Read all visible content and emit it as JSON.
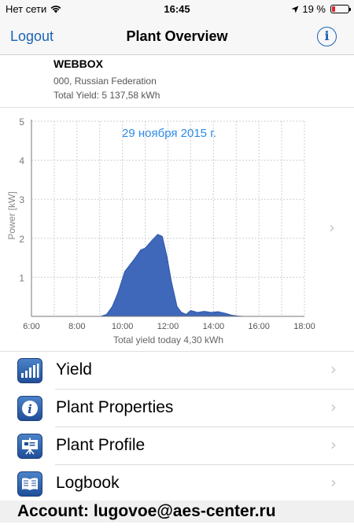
{
  "status_bar": {
    "carrier": "Нет сети",
    "time": "16:45",
    "battery": "19 %",
    "battery_level": 0.19
  },
  "nav": {
    "logout": "Logout",
    "title": "Plant Overview",
    "info_icon": "info-circle-icon"
  },
  "plant": {
    "name": "WEBBOX",
    "location": "000, Russian Federation",
    "total_yield": "Total Yield: 5 137,58 kWh"
  },
  "chart_data": {
    "type": "area",
    "title": "29 ноября 2015 г.",
    "ylabel": "Power [kW]",
    "xlabel": "Total yield today 4,30 kWh",
    "ylim": [
      0,
      5
    ],
    "xlim": [
      6,
      18
    ],
    "y_ticks": [
      "1",
      "2",
      "3",
      "4",
      "5"
    ],
    "x_ticks": [
      "6:00",
      "8:00",
      "10:00",
      "12:00",
      "14:00",
      "16:00",
      "18:00"
    ],
    "x_tick_values": [
      6,
      8,
      10,
      12,
      14,
      16,
      18
    ],
    "grid": true,
    "color": "#3f68ba",
    "x": [
      6,
      9.05,
      9.3,
      9.55,
      9.8,
      10.1,
      10.5,
      10.8,
      11.0,
      11.3,
      11.55,
      11.75,
      11.95,
      12.15,
      12.4,
      12.6,
      12.8,
      13.0,
      13.3,
      13.6,
      13.9,
      14.2,
      14.5,
      14.8,
      15.05,
      15.3,
      18
    ],
    "y": [
      0,
      0,
      0.05,
      0.25,
      0.6,
      1.15,
      1.45,
      1.7,
      1.75,
      1.95,
      2.1,
      2.05,
      1.55,
      0.9,
      0.25,
      0.1,
      0.05,
      0.15,
      0.1,
      0.13,
      0.1,
      0.12,
      0.08,
      0.03,
      0.01,
      0,
      0
    ]
  },
  "menu": [
    {
      "label": "Yield",
      "icon": "bar-chart-icon"
    },
    {
      "label": "Plant Properties",
      "icon": "info-icon"
    },
    {
      "label": "Plant Profile",
      "icon": "presentation-icon"
    },
    {
      "label": "Logbook",
      "icon": "book-icon"
    }
  ],
  "footer": {
    "account": "Account: lugovoe@aes-center.ru"
  }
}
